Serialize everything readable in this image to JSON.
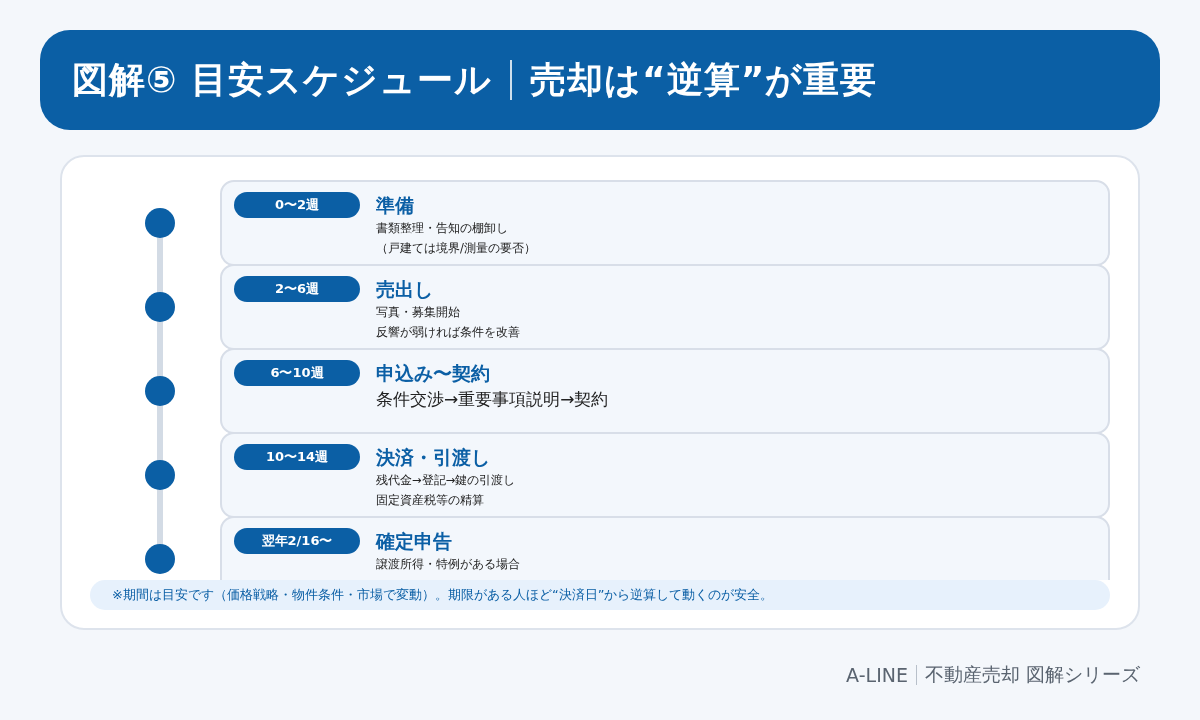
{
  "header": {
    "title": "図解⑤ 目安スケジュール",
    "subtitle": "売却は“逆算”が重要"
  },
  "steps": [
    {
      "period": "0〜2週",
      "title": "準備",
      "kind": "notes",
      "lines": [
        "書類整理・告知の棚卸し",
        "（戸建ては境界/測量の要否）"
      ]
    },
    {
      "period": "2〜6週",
      "title": "売出し",
      "kind": "notes",
      "lines": [
        "写真・募集開始",
        "反響が弱ければ条件を改善"
      ]
    },
    {
      "period": "6〜10週",
      "title": "申込み〜契約",
      "kind": "lead",
      "lines": [
        "条件交渉→重要事項説明→契約"
      ]
    },
    {
      "period": "10〜14週",
      "title": "決済・引渡し",
      "kind": "notes",
      "lines": [
        "残代金→登記→鍵の引渡し",
        "固定資産税等の精算"
      ]
    },
    {
      "period": "翌年2/16〜",
      "title": "確定申告",
      "kind": "notes",
      "lines": [
        "譲渡所得・特例がある場合"
      ]
    }
  ],
  "note": "※期間は目安です（価格戦略・物件条件・市場で変動）。期限がある人ほど“決済日”から逆算して動くのが安全。",
  "footer": {
    "brand": "A-LINE",
    "series": "不動産売却 図解シリーズ"
  }
}
